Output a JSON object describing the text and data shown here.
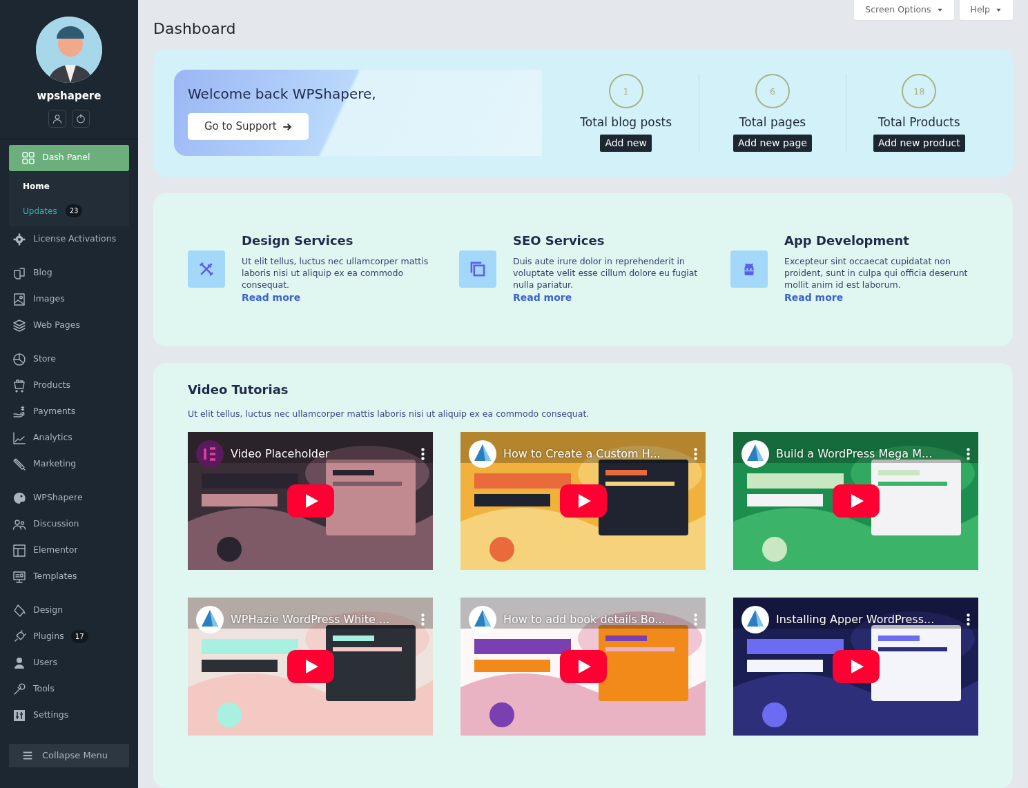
{
  "sidebar": {
    "username": "wpshapere",
    "sections": [
      [
        {
          "label": "Dash Panel",
          "selected": true,
          "expanded": true,
          "children": [
            {
              "label": "Home",
              "selected": true
            },
            {
              "label": "Updates",
              "selected": false,
              "badge": "23"
            }
          ]
        },
        {
          "label": "License Activations",
          "selected": false
        }
      ],
      [
        {
          "label": "Blog",
          "selected": false
        },
        {
          "label": "Images",
          "selected": false
        },
        {
          "label": "Web Pages",
          "selected": false
        }
      ],
      [
        {
          "label": "Store",
          "selected": false
        },
        {
          "label": "Products",
          "selected": false
        },
        {
          "label": "Payments",
          "selected": false
        },
        {
          "label": "Analytics",
          "selected": false
        },
        {
          "label": "Marketing",
          "selected": false
        }
      ],
      [
        {
          "label": "WPShapere",
          "selected": false
        },
        {
          "label": "Discussion",
          "selected": false
        },
        {
          "label": "Elementor",
          "selected": false
        },
        {
          "label": "Templates",
          "selected": false
        }
      ],
      [
        {
          "label": "Design",
          "selected": false
        },
        {
          "label": "Plugins",
          "selected": false,
          "badge": "17"
        },
        {
          "label": "Users",
          "selected": false
        },
        {
          "label": "Tools",
          "selected": false
        },
        {
          "label": "Settings",
          "selected": false
        }
      ]
    ],
    "collapse_label": "Collapse Menu"
  },
  "top_buttons": [
    {
      "label": "Screen Options"
    },
    {
      "label": "Help"
    }
  ],
  "page_title": "Dashboard",
  "welcome": {
    "title": "Welcome back WPShapere,",
    "button": "Go to Support"
  },
  "stats": [
    {
      "count": "1",
      "label": "Total blog posts",
      "action": "Add new"
    },
    {
      "count": "6",
      "label": "Total pages",
      "action": "Add new page"
    },
    {
      "count": "18",
      "label": "Total Products",
      "action": "Add new product"
    }
  ],
  "services": [
    {
      "title": "Design Services",
      "text": "Ut elit tellus, luctus nec ullamcorper mattis  laboris nisi ut aliquip ex ea commodo consequat.",
      "link": "Read more"
    },
    {
      "title": "SEO Services",
      "text": "Duis aute irure dolor in reprehenderit in voluptate velit esse cillum dolore eu fugiat nulla pariatur.",
      "link": "Read more"
    },
    {
      "title": "App Development",
      "text": "Excepteur sint occaecat cupidatat non proident, sunt in culpa qui officia deserunt mollit anim id est laborum.",
      "link": "Read more"
    }
  ],
  "videos": {
    "title": "Video Tutorias",
    "text": "Ut elit tellus, luctus nec ullamcorper mattis  laboris nisi ut aliquip ex ea commodo consequat.",
    "items": [
      {
        "title": "Video Placeholder",
        "kind": "picture"
      },
      {
        "title": "How to Create a Custom H...",
        "kind": "picture"
      },
      {
        "title": "Build a WordPress Mega M...",
        "kind": "picture"
      },
      {
        "title": "WPHazie WordPress White ...",
        "kind": "picture"
      },
      {
        "title": "How to add book details Bo...",
        "kind": "picture"
      },
      {
        "title": "Installing Apper WordPress...",
        "kind": "picture"
      }
    ]
  }
}
